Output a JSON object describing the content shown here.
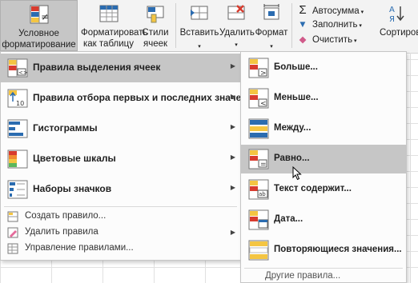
{
  "ribbon": {
    "conditional_formatting": "Условное форматирование",
    "format_as_table": "Форматировать как таблицу",
    "cell_styles": "Стили ячеек",
    "insert": "Вставить",
    "delete": "Удалить",
    "format": "Формат",
    "autosum": "Автосумма",
    "fill": "Заполнить",
    "clear": "Очистить",
    "sort_filter": "Сортировка и фильтр"
  },
  "menu": {
    "items": [
      {
        "label": "Правила выделения ячеек",
        "icon": "highlight-rules-icon",
        "highlighted": true
      },
      {
        "label": "Правила отбора первых и последних значений",
        "icon": "top-bottom-rules-icon"
      },
      {
        "label": "Гистограммы",
        "icon": "data-bars-icon"
      },
      {
        "label": "Цветовые шкалы",
        "icon": "color-scales-icon"
      },
      {
        "label": "Наборы значков",
        "icon": "icon-sets-icon"
      }
    ],
    "small_items": [
      {
        "label": "Создать правило...",
        "icon": "new-rule-icon"
      },
      {
        "label": "Удалить правила",
        "icon": "clear-rules-icon"
      },
      {
        "label": "Управление правилами...",
        "icon": "manage-rules-icon"
      }
    ]
  },
  "submenu": {
    "items": [
      {
        "label": "Больше...",
        "icon": "greater-than-icon"
      },
      {
        "label": "Меньше...",
        "icon": "less-than-icon"
      },
      {
        "label": "Между...",
        "icon": "between-icon"
      },
      {
        "label": "Равно...",
        "icon": "equal-to-icon",
        "highlighted": true
      },
      {
        "label": "Текст содержит...",
        "icon": "text-contains-icon"
      },
      {
        "label": "Дата...",
        "icon": "date-occurring-icon"
      },
      {
        "label": "Повторяющиеся значения...",
        "icon": "duplicate-values-icon"
      }
    ],
    "more_rules": "Другие правила..."
  },
  "colors": {
    "highlight": "#c6c6c6",
    "menu_bg": "#fcfcfc",
    "ribbon_bg": "#f3f3f3",
    "accent_yellow": "#f4c542",
    "accent_red": "#d83b2e",
    "accent_blue": "#2b6cb0"
  }
}
